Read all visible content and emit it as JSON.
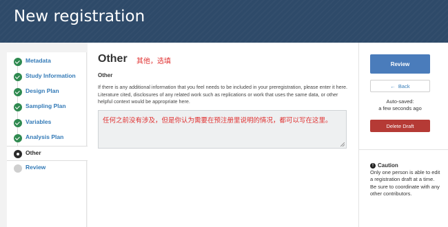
{
  "header": {
    "title": "New registration"
  },
  "sidebar": {
    "items": [
      {
        "label": "Metadata",
        "state": "done"
      },
      {
        "label": "Study Information",
        "state": "done"
      },
      {
        "label": "Design Plan",
        "state": "done"
      },
      {
        "label": "Sampling Plan",
        "state": "done"
      },
      {
        "label": "Variables",
        "state": "done"
      },
      {
        "label": "Analysis Plan",
        "state": "done"
      },
      {
        "label": "Other",
        "state": "current"
      },
      {
        "label": "Review",
        "state": "todo"
      }
    ]
  },
  "main": {
    "title": "Other",
    "annotation": "其他，选填",
    "field_label": "Other",
    "help_text": "If there is any additional information that you feel needs to be included in your preregistration, please enter it here. Literature cited, disclosures of any related work such as replications or work that uses the same data, or other helpful context would be appropriate here.",
    "textarea_value": "任何之前没有涉及，但是你认为需要在预注册里说明的情况，都可以写在这里。"
  },
  "right_panel": {
    "review_label": "Review",
    "back_label": "Back",
    "autosave_line1": "Auto-saved:",
    "autosave_line2": "a few seconds ago",
    "delete_label": "Delete Draft",
    "caution_title": "Caution",
    "caution_text": "Only one person is able to edit a registration draft at a time. Be sure to coordinate with any other contributors."
  },
  "colors": {
    "header_bg": "#2e4a69",
    "check_green": "#2f8a50",
    "link_blue": "#337ab7",
    "review_button": "#4a7cbb",
    "delete_button": "#b53a35",
    "annotation_red": "#e03030"
  },
  "icons": {
    "done": "check-circle-icon",
    "current": "current-step-icon",
    "todo": "pending-step-icon",
    "back": "arrow-left-icon",
    "caution": "exclamation-circle-icon"
  }
}
